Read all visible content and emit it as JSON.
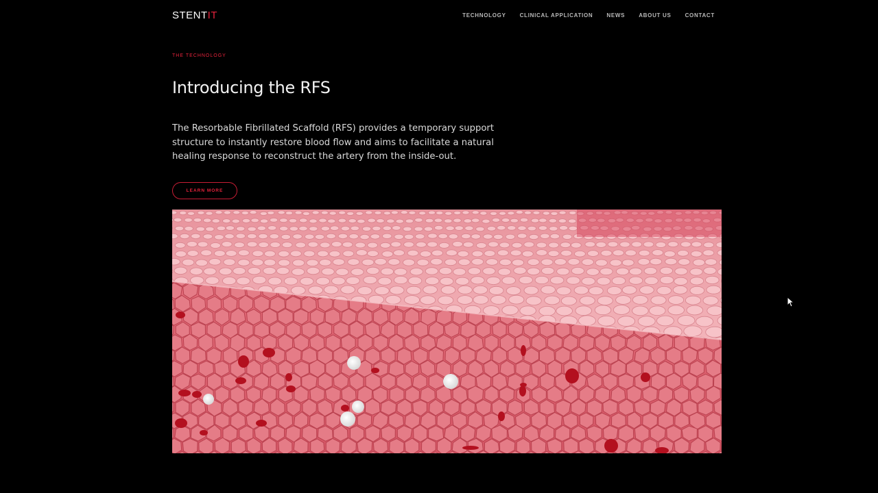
{
  "header": {
    "logo": {
      "main": "STENT",
      "accent": "IT"
    },
    "nav": [
      "TECHNOLOGY",
      "CLINICAL APPLICATION",
      "NEWS",
      "ABOUT US",
      "CONTACT"
    ]
  },
  "hero": {
    "eyebrow": "THE TECHNOLOGY",
    "title": "Introducing the RFS",
    "lead": "The Resorbable Fibrillated Scaffold (RFS) provides a temporary support structure to instantly restore blood flow and aims to facilitate a natural healing response to reconstruct the artery from the inside-out.",
    "cta": "LEARN MORE"
  },
  "media": {
    "icon": "tissue-illustration",
    "colors": {
      "top_surface": "#f0a0a8",
      "top_cell": "#f7c3c8",
      "side_surface": "#d9616e",
      "side_cell": "#e57c87",
      "red_cell": "#b3101f",
      "white_cell": "#ffffff"
    }
  },
  "colors": {
    "background": "#000000",
    "accent": "#e8233c",
    "nav_text": "#b9b9b9",
    "body_text": "#dadada"
  }
}
